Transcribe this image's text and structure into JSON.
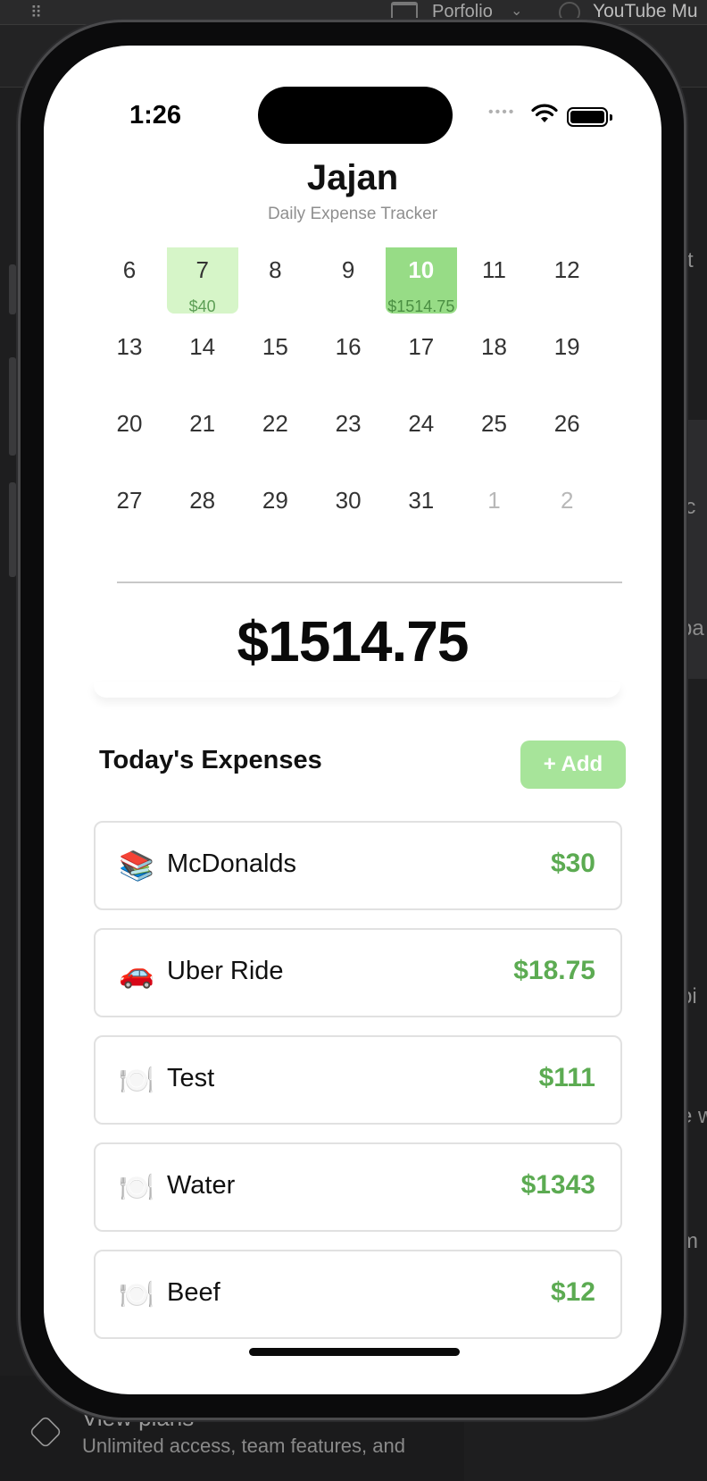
{
  "background": {
    "tabs": [
      {
        "label": "Porfolio",
        "icon": "folder-icon"
      },
      {
        "label": "YouTube Mu",
        "icon": "youtube-icon"
      }
    ],
    "right_fragments": [
      "rt",
      "-",
      "ic",
      "pa",
      "pi",
      "e w",
      "m"
    ],
    "plans": {
      "title": "View plans",
      "subtitle": "Unlimited access, team features, and"
    }
  },
  "status_bar": {
    "time": "1:26"
  },
  "app": {
    "title": "Jajan",
    "subtitle": "Daily Expense Tracker"
  },
  "calendar": {
    "weeks": [
      [
        {
          "day": "6"
        },
        {
          "day": "7",
          "amount": "$40"
        },
        {
          "day": "8"
        },
        {
          "day": "9"
        },
        {
          "day": "10",
          "amount": "$1514.75",
          "selected": true
        },
        {
          "day": "11"
        },
        {
          "day": "12"
        }
      ],
      [
        {
          "day": "13"
        },
        {
          "day": "14"
        },
        {
          "day": "15"
        },
        {
          "day": "16"
        },
        {
          "day": "17"
        },
        {
          "day": "18"
        },
        {
          "day": "19"
        }
      ],
      [
        {
          "day": "20"
        },
        {
          "day": "21"
        },
        {
          "day": "22"
        },
        {
          "day": "23"
        },
        {
          "day": "24"
        },
        {
          "day": "25"
        },
        {
          "day": "26"
        }
      ],
      [
        {
          "day": "27"
        },
        {
          "day": "28"
        },
        {
          "day": "29"
        },
        {
          "day": "30"
        },
        {
          "day": "31"
        },
        {
          "day": "1",
          "muted": true
        },
        {
          "day": "2",
          "muted": true
        }
      ]
    ],
    "colors": {
      "expense_day": "#d6f5c8",
      "selected_day": "#97dc86"
    }
  },
  "total": {
    "amount": "$1514.75"
  },
  "expenses": {
    "title": "Today's Expenses",
    "add_label": "+ Add",
    "items": [
      {
        "icon": "📚",
        "icon_name": "books-icon",
        "name": "McDonalds",
        "amount": "$30"
      },
      {
        "icon": "🚗",
        "icon_name": "car-icon",
        "name": "Uber Ride",
        "amount": "$18.75"
      },
      {
        "icon": "🍽️",
        "icon_name": "plate-icon",
        "name": "Test",
        "amount": "$111"
      },
      {
        "icon": "🍽️",
        "icon_name": "plate-icon",
        "name": "Water",
        "amount": "$1343"
      },
      {
        "icon": "🍽️",
        "icon_name": "plate-icon",
        "name": "Beef",
        "amount": "$12"
      }
    ],
    "colors": {
      "amount": "#5cab52",
      "add_button": "#a7e49a"
    }
  }
}
